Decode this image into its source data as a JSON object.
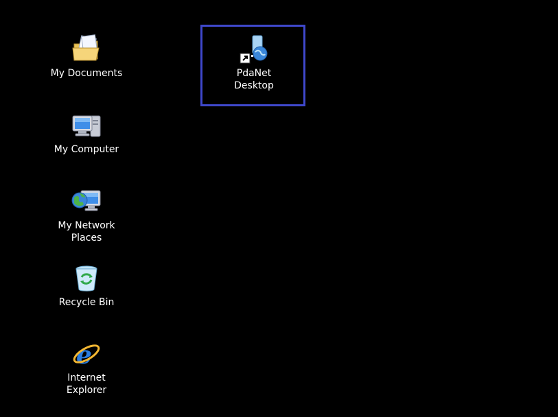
{
  "desktop": {
    "icons": [
      {
        "label": "My Documents"
      },
      {
        "label": "My Computer"
      },
      {
        "label": "My Network\nPlaces"
      },
      {
        "label": "Recycle Bin"
      },
      {
        "label": "Internet\nExplorer"
      },
      {
        "label": "PdaNet\nDesktop"
      }
    ]
  },
  "colors": {
    "background": "#000000",
    "highlight_border": "#3f48cc",
    "label_text": "#ffffff"
  }
}
